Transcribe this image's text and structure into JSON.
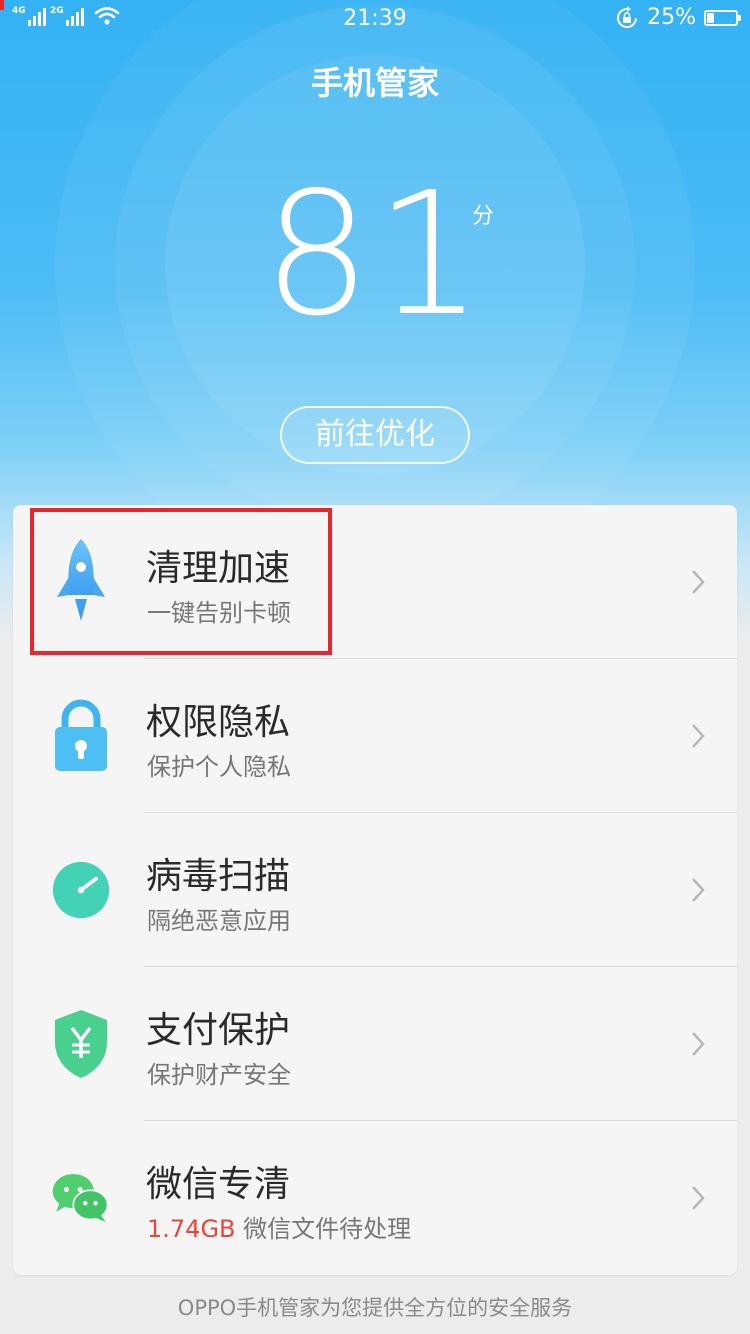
{
  "status_bar": {
    "network_1": "4G",
    "network_2": "2G",
    "time": "21:39",
    "battery": "25%",
    "battery_level": 0.25,
    "icons": [
      "signal-icon",
      "signal-icon",
      "wifi-icon",
      "rotation-lock-icon",
      "battery-icon"
    ]
  },
  "header": {
    "title": "手机管家",
    "score": "81",
    "score_unit": "分",
    "optimize_button": "前往优化"
  },
  "menu": {
    "items": [
      {
        "title": "清理加速",
        "subtitle": "一键告别卡顿",
        "icon": "rocket-icon"
      },
      {
        "title": "权限隐私",
        "subtitle": "保护个人隐私",
        "icon": "lock-icon"
      },
      {
        "title": "病毒扫描",
        "subtitle": "隔绝恶意应用",
        "icon": "speedometer-icon"
      },
      {
        "title": "支付保护",
        "subtitle": "保护财产安全",
        "icon": "yuan-shield-icon"
      },
      {
        "title": "微信专清",
        "subtitle_highlight": "1.74GB",
        "subtitle": " 微信文件待处理",
        "icon": "wechat-icon"
      }
    ]
  },
  "footer": {
    "text": "OPPO手机管家为您提供全方位的安全服务"
  },
  "colors": {
    "hero_blue": "#33b2f4",
    "highlight_red": "#e8262d",
    "size_red": "#e8453c"
  }
}
